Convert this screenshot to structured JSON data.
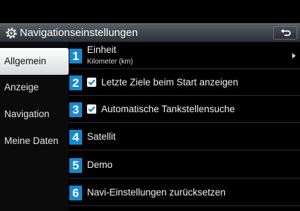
{
  "header": {
    "title": "Navigationseinstellungen",
    "icon": "gear-icon",
    "back_icon": "back-arrow-icon"
  },
  "sidebar": {
    "items": [
      {
        "label": "Allgemein",
        "active": true
      },
      {
        "label": "Anzeige",
        "active": false
      },
      {
        "label": "Navigation",
        "active": false
      },
      {
        "label": "Meine Daten",
        "active": false
      }
    ]
  },
  "content": {
    "rows": [
      {
        "number": "1",
        "label": "Einheit",
        "value": "Kilometer (km)",
        "has_arrow": true
      },
      {
        "number": "2",
        "label": "Letzte Ziele beim Start anzeigen",
        "checked": true
      },
      {
        "number": "3",
        "label": "Automatische Tankstellensuche",
        "checked": true
      },
      {
        "number": "4",
        "label": "Satellit"
      },
      {
        "number": "5",
        "label": "Demo"
      },
      {
        "number": "6",
        "label": "Navi-Einstellungen zurücksetzen"
      }
    ]
  },
  "colors": {
    "accent_badge": "#1688cf",
    "active_tab_bg": "#ffffff",
    "header_bg": "#3c4048"
  }
}
